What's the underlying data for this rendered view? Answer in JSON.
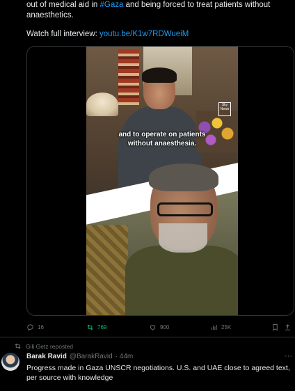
{
  "tweet": {
    "line1_prefix": "out of medical aid in ",
    "hashtag": "#Gaza",
    "line1_suffix": " and being forced to treat patients without",
    "line2": "anaesthetics.",
    "watch_label": "Watch full interview: ",
    "watch_link": "youtu.be/K1w7RDWueiM"
  },
  "video": {
    "caption_line1": "and to operate on patients",
    "caption_line2": "without anaesthesia.",
    "watermark": "Sky News"
  },
  "actions": {
    "replies": "16",
    "retweets": "769",
    "likes": "900",
    "views": "25K"
  },
  "next_tweet": {
    "repost_label": "Gili Getz reposted",
    "name": "Barak Ravid",
    "handle": "@BarakRavid",
    "time": "· 44m",
    "more": "···",
    "text": "Progress made in Gaza UNSCR negotiations. U.S. and UAE close to agreed text, per source with knowledge"
  },
  "colors": {
    "background": "#000000",
    "text": "#e7e9ea",
    "muted": "#71767b",
    "accent": "#1d9bf0",
    "retweet": "#00ba7c",
    "border": "#2f3336"
  },
  "icons": [
    "reply-icon",
    "retweet-icon",
    "like-icon",
    "views-icon",
    "bookmark-icon",
    "repost-icon"
  ]
}
